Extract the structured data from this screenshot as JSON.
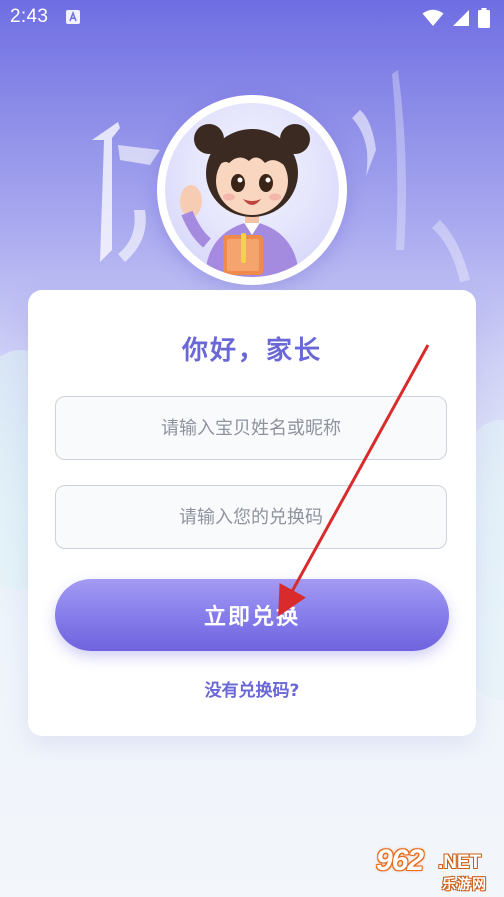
{
  "status_bar": {
    "time": "2:43",
    "icons": [
      "a-notification-icon",
      "wifi-icon",
      "signal-icon",
      "battery-icon"
    ]
  },
  "avatar": {
    "description_icon": "girl-mascot-avatar"
  },
  "card": {
    "greeting": "你好，家长",
    "name_field": {
      "placeholder": "请输入宝贝姓名或昵称",
      "value": ""
    },
    "code_field": {
      "placeholder": "请输入您的兑换码",
      "value": ""
    },
    "redeem_button": "立即兑换",
    "no_code_link": "没有兑换码?"
  },
  "watermark": {
    "number": "962",
    "suffix": ".NET",
    "site_name": "乐游网"
  },
  "colors": {
    "accent": "#6a67d6",
    "button_top": "#a39bf3",
    "button_bottom": "#6e63de",
    "annotation_arrow": "#d92b2b",
    "watermark_orange": "#e86a1a"
  }
}
